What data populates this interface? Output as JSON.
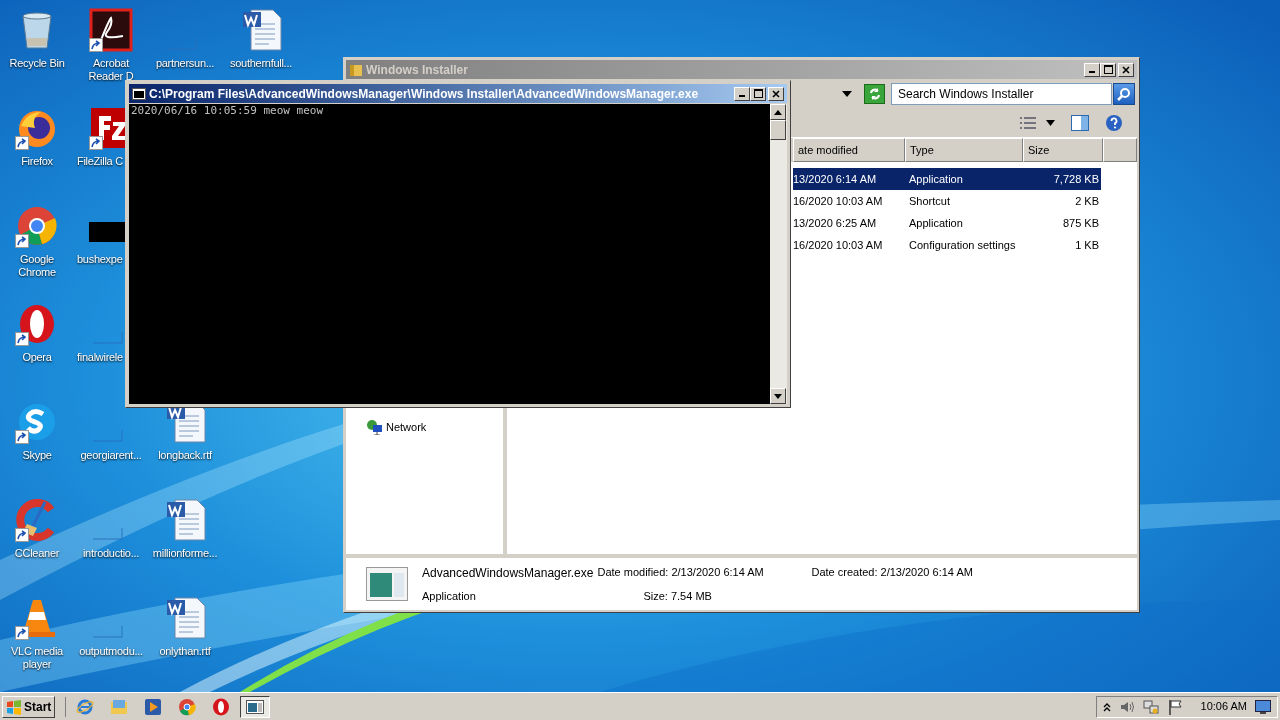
{
  "desktop_icons": [
    {
      "label": "Recycle Bin",
      "kind": "recycle-bin",
      "shortcut": false
    },
    {
      "label": "Firefox",
      "kind": "firefox",
      "shortcut": true
    },
    {
      "label": "Google Chrome",
      "kind": "chrome",
      "shortcut": true
    },
    {
      "label": "Opera",
      "kind": "opera",
      "shortcut": true
    },
    {
      "label": "Skype",
      "kind": "skype",
      "shortcut": true
    },
    {
      "label": "CCleaner",
      "kind": "ccleaner",
      "shortcut": true
    },
    {
      "label": "VLC media player",
      "kind": "vlc",
      "shortcut": true
    },
    {
      "label": "Acrobat Reader D",
      "kind": "acrobat",
      "shortcut": true
    },
    {
      "label": "FileZilla C",
      "kind": "filezilla",
      "shortcut": true
    },
    {
      "label": "bushexpe",
      "kind": "dark-file",
      "shortcut": false
    },
    {
      "label": "finalwirele",
      "kind": "blank-file",
      "shortcut": false
    },
    {
      "label": "georgiarent...",
      "kind": "blank-file",
      "shortcut": false
    },
    {
      "label": "introductio...",
      "kind": "blank-file",
      "shortcut": false
    },
    {
      "label": "outputmodu...",
      "kind": "blank-file",
      "shortcut": false
    },
    {
      "label": "partnersun...",
      "kind": "blank-file",
      "shortcut": false
    },
    {
      "label": "longback.rtf",
      "kind": "word",
      "shortcut": false
    },
    {
      "label": "millionforme...",
      "kind": "word",
      "shortcut": false
    },
    {
      "label": "onlythan.rtf",
      "kind": "word",
      "shortcut": false
    },
    {
      "label": "southernfull...",
      "kind": "word",
      "shortcut": false
    }
  ],
  "explorer": {
    "title": "Windows Installer",
    "active": false,
    "search": {
      "placeholder": "Search Windows Installer"
    },
    "columns": [
      "ate modified",
      "Type",
      "Size"
    ],
    "rows": [
      {
        "date": "13/2020 6:14 AM",
        "type": "Application",
        "size": "7,728 KB",
        "selected": true
      },
      {
        "date": "16/2020 10:03 AM",
        "type": "Shortcut",
        "size": "2 KB",
        "selected": false
      },
      {
        "date": "13/2020 6:25 AM",
        "type": "Application",
        "size": "875 KB",
        "selected": false
      },
      {
        "date": "16/2020 10:03 AM",
        "type": "Configuration settings",
        "size": "1 KB",
        "selected": false
      }
    ],
    "nav": [
      {
        "label": "Network"
      }
    ],
    "details": {
      "name": "AdvancedWindowsManager.exe",
      "type": "Application",
      "modified": "Date modified: 2/13/2020 6:14 AM",
      "size": "Size: 7.54 MB",
      "created": "Date created: 2/13/2020 6:14 AM"
    }
  },
  "console": {
    "title": "C:\\Program Files\\AdvancedWindowsManager\\Windows Installer\\AdvancedWindowsManager.exe",
    "active": true,
    "lines": [
      "2020/06/16 10:05:59 meow meow"
    ]
  },
  "taskbar": {
    "start": "Start",
    "tasks": [
      {
        "kind": "ie",
        "selected": false
      },
      {
        "kind": "explorer",
        "selected": false
      },
      {
        "kind": "media",
        "selected": false
      },
      {
        "kind": "chrome",
        "selected": false
      },
      {
        "kind": "opera",
        "selected": false
      },
      {
        "kind": "console",
        "selected": true
      }
    ],
    "clock": "10:06 AM"
  }
}
